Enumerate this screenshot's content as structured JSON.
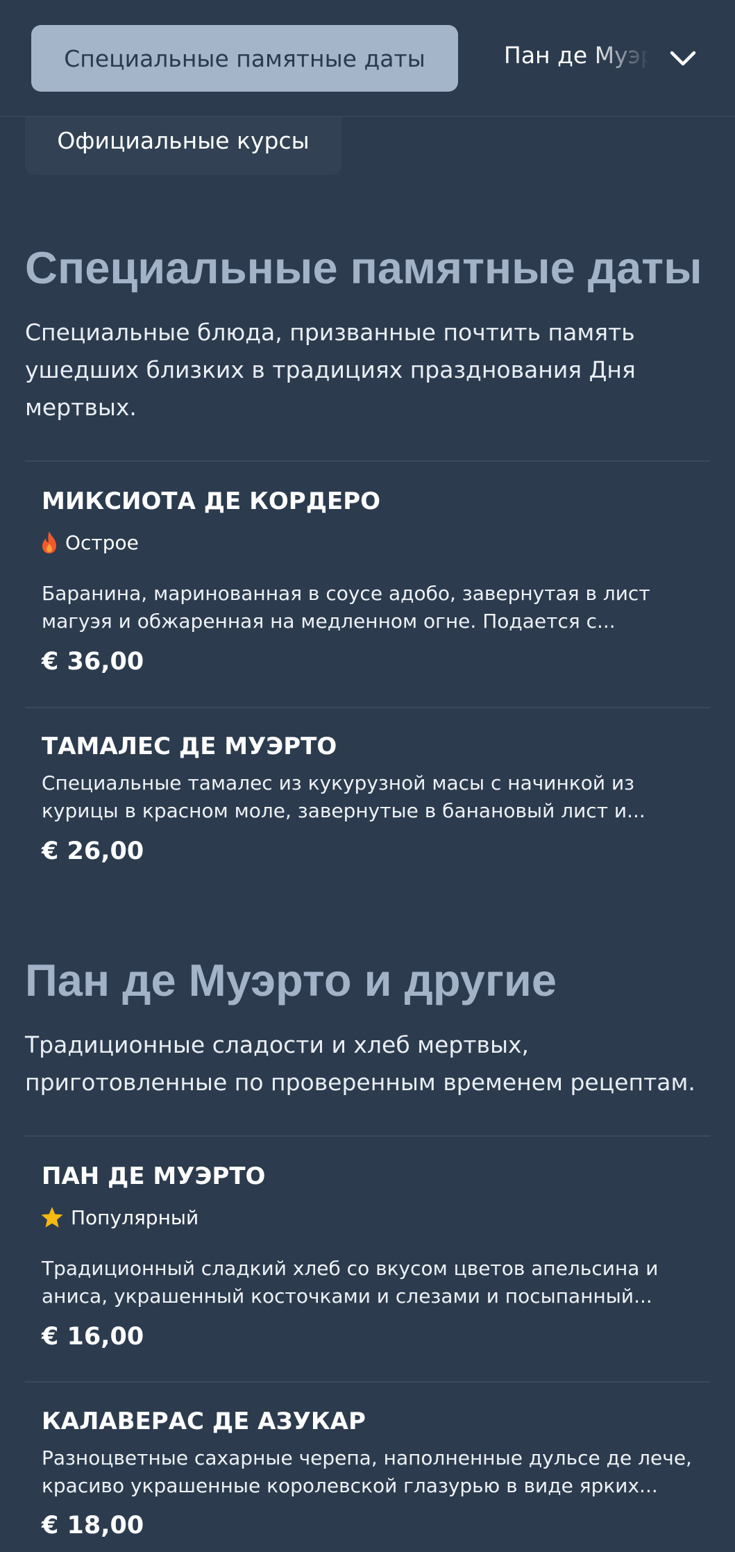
{
  "nav": {
    "active_tab": "Специальные памятные даты",
    "next_tab": "Пан де Муэрто и другие",
    "courses_tab": "Официальные курсы"
  },
  "sections": [
    {
      "title": "Специальные памятные даты",
      "description": "Специальные блюда, призванные почтить память ушедших близких в традициях празднования Дня мертвых.",
      "items": [
        {
          "name": "МИКСИОТА ДЕ КОРДЕРО",
          "tag": "Острое",
          "description_line1": "Баранина, маринованная в соусе адобо, завернутая в лист",
          "description_line2": "магуэя и обжаренная на медленном огне. Подается с...",
          "price": "€ 36,00"
        },
        {
          "name": "ТАМАЛЕС ДЕ МУЭРТО",
          "description_line1": "Специальные тамалес из кукурузной масы с начинкой из",
          "description_line2": "курицы в красном моле, завернутые в банановый лист и...",
          "price": "€ 26,00"
        }
      ]
    },
    {
      "title": "Пан де Муэрто и другие",
      "description": "Традиционные сладости и хлеб мертвых, приготовленные по проверенным временем рецептам.",
      "items": [
        {
          "name": "ПАН ДЕ МУЭРТО",
          "tag": "Популярный",
          "description_line1": "Традиционный сладкий хлеб со вкусом цветов апельсина и",
          "description_line2": "аниса, украшенный косточками и слезами и посыпанный...",
          "price": "€ 16,00"
        },
        {
          "name": "КАЛАВЕРАС ДЕ АЗУКАР",
          "description_line1": "Разноцветные сахарные черепа, наполненные дульсе де лече,",
          "description_line2": "красиво украшенные королевской глазурью в виде ярких...",
          "price": "€ 18,00"
        }
      ]
    }
  ],
  "colors": {
    "background": "#2c3b4e",
    "active_tab_bg": "#a5b5c9",
    "section_title": "#a2b3c8",
    "spicy_icon": "#f1592a",
    "popular_icon": "#f5b90f"
  },
  "icons": {
    "spicy": "flame-icon",
    "popular": "star-icon",
    "expand": "chevron-down-icon"
  }
}
